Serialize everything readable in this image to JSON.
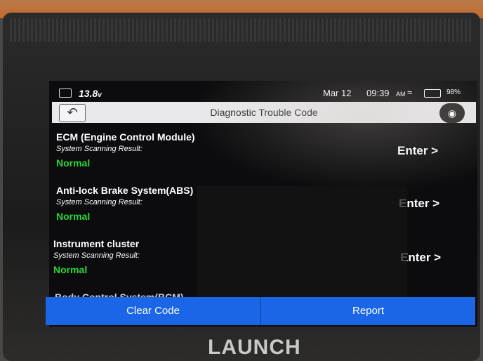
{
  "status_bar": {
    "voltage": "13.8",
    "voltage_unit": "v",
    "date": "Mar 12",
    "time": "09:39",
    "ampm": "AM",
    "battery_pct": "98%"
  },
  "header": {
    "title": "Diagnostic Trouble Code",
    "back_icon": "back-arrow-icon",
    "screenshot_icon": "camera-icon"
  },
  "systems": [
    {
      "name": "ECM (Engine Control Module)",
      "result_label": "System Scanning Result:",
      "status": "Normal",
      "action": "Enter >"
    },
    {
      "name": "Anti-lock Brake System(ABS)",
      "result_label": "System Scanning Result:",
      "status": "Normal",
      "action": "Enter >"
    },
    {
      "name": "Instrument cluster",
      "result_label": "System Scanning Result:",
      "status": "Normal",
      "action": "Enter >"
    },
    {
      "name": "Body Control System(BCM)"
    }
  ],
  "footer": {
    "clear_label": "Clear Code",
    "report_label": "Report"
  },
  "device": {
    "brand": "LAUNCH"
  },
  "colors": {
    "accent_blue": "#1a66e6",
    "status_green": "#2bd43a"
  }
}
